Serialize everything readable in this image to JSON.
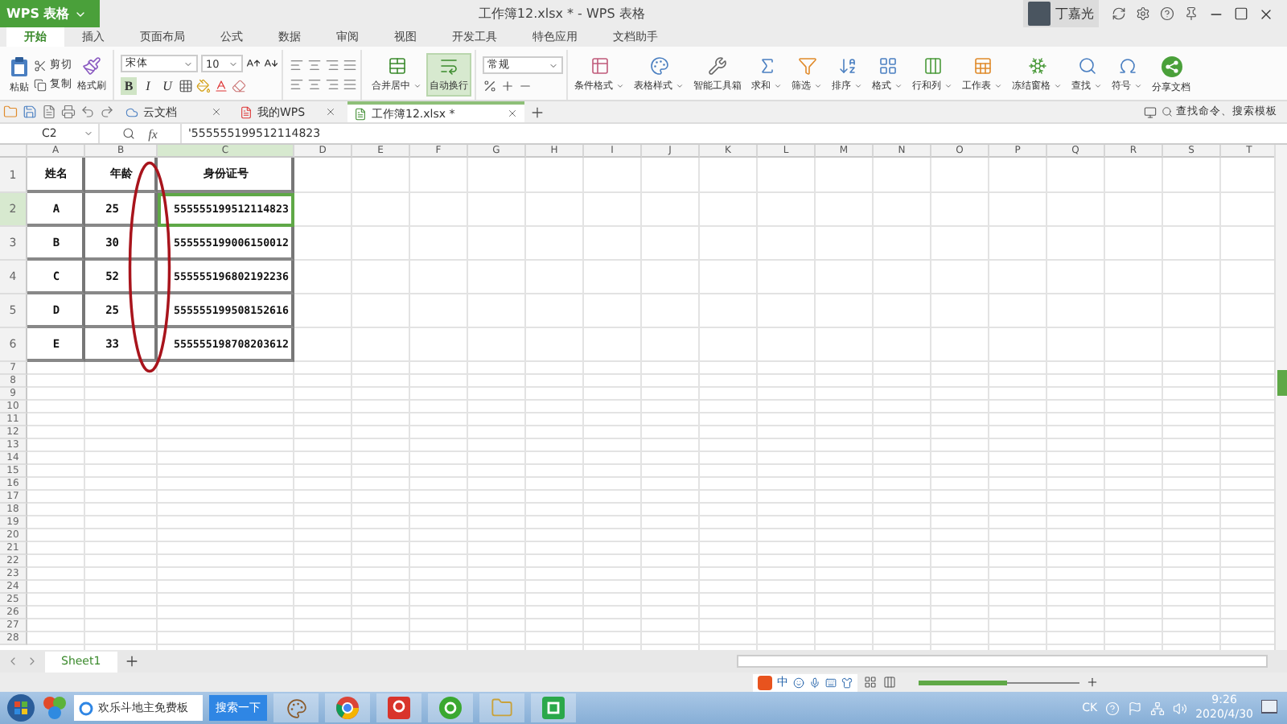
{
  "app_tag": "WPS 表格",
  "title": "工作簿12.xlsx * - WPS 表格",
  "user": "丁嘉光",
  "menu_tabs": [
    {
      "label": "开始",
      "selected": true
    },
    {
      "label": "插入",
      "selected": false
    },
    {
      "label": "页面布局",
      "selected": false
    },
    {
      "label": "公式",
      "selected": false
    },
    {
      "label": "数据",
      "selected": false
    },
    {
      "label": "审阅",
      "selected": false
    },
    {
      "label": "视图",
      "selected": false
    },
    {
      "label": "开发工具",
      "selected": false
    },
    {
      "label": "特色应用",
      "selected": false
    },
    {
      "label": "文档助手",
      "selected": false
    }
  ],
  "clipboard": {
    "paste": "粘贴",
    "cut": "剪切",
    "copy": "复制",
    "format_painter": "格式刷"
  },
  "font": {
    "name": "宋体",
    "size": "10",
    "styles": [
      {
        "label": "B",
        "selected": true
      },
      {
        "label": "I",
        "selected": false
      },
      {
        "label": "U",
        "selected": false
      }
    ]
  },
  "merge_buttons": [
    {
      "label": "合并居中",
      "menu": true,
      "selected": false
    },
    {
      "label": "自动换行",
      "menu": false,
      "selected": true
    }
  ],
  "number_format": "常规",
  "tool_buttons": [
    {
      "label": "条件格式",
      "menu": true
    },
    {
      "label": "表格样式",
      "menu": true
    },
    {
      "label": "智能工具箱",
      "menu": false
    },
    {
      "label": "求和",
      "menu": true
    },
    {
      "label": "筛选",
      "menu": true
    },
    {
      "label": "排序",
      "menu": true
    },
    {
      "label": "格式",
      "menu": true
    },
    {
      "label": "行和列",
      "menu": true
    },
    {
      "label": "工作表",
      "menu": true
    },
    {
      "label": "冻结窗格",
      "menu": true
    },
    {
      "label": "查找",
      "menu": true
    },
    {
      "label": "符号",
      "menu": true
    },
    {
      "label": "分享文档",
      "menu": false
    }
  ],
  "doc_tabs": [
    {
      "label": "云文档",
      "selected": false
    },
    {
      "label": "我的WPS",
      "selected": false
    },
    {
      "label": "工作簿12.xlsx *",
      "selected": true
    }
  ],
  "command_search": {
    "placeholder": "查找命令、搜索模板"
  },
  "name_box": "C2",
  "formula": "'555555199512114823",
  "function_label": "fx",
  "columns": [
    {
      "label": "A",
      "selected": false
    },
    {
      "label": "B",
      "selected": false
    },
    {
      "label": "C",
      "selected": true
    },
    {
      "label": "D",
      "selected": false
    },
    {
      "label": "E",
      "selected": false
    },
    {
      "label": "F",
      "selected": false
    },
    {
      "label": "G",
      "selected": false
    },
    {
      "label": "H",
      "selected": false
    },
    {
      "label": "I",
      "selected": false
    },
    {
      "label": "J",
      "selected": false
    },
    {
      "label": "K",
      "selected": false
    },
    {
      "label": "L",
      "selected": false
    },
    {
      "label": "M",
      "selected": false
    },
    {
      "label": "N",
      "selected": false
    },
    {
      "label": "O",
      "selected": false
    },
    {
      "label": "P",
      "selected": false
    },
    {
      "label": "Q",
      "selected": false
    },
    {
      "label": "R",
      "selected": false
    },
    {
      "label": "S",
      "selected": false
    },
    {
      "label": "T",
      "selected": false
    }
  ],
  "rows": [
    {
      "number": "1",
      "selected": false,
      "cells": [
        "姓名",
        "年龄",
        "身份证号"
      ]
    },
    {
      "number": "2",
      "selected": true,
      "cells": [
        "A",
        "25",
        "555555199512114823"
      ]
    },
    {
      "number": "3",
      "selected": false,
      "cells": [
        "B",
        "30",
        "555555199006150012"
      ]
    },
    {
      "number": "4",
      "selected": false,
      "cells": [
        "C",
        "52",
        "555555196802192236"
      ]
    },
    {
      "number": "5",
      "selected": false,
      "cells": [
        "D",
        "25",
        "555555199508152616"
      ]
    },
    {
      "number": "6",
      "selected": false,
      "cells": [
        "E",
        "33",
        "555555198708203612"
      ]
    }
  ],
  "empty_rows": [
    "7",
    "8",
    "9",
    "10",
    "11",
    "12",
    "13",
    "14",
    "15",
    "16",
    "17",
    "18",
    "19",
    "20",
    "21",
    "22",
    "23",
    "24",
    "25",
    "26",
    "27",
    "28"
  ],
  "sheet_tabs": [
    {
      "label": "Sheet1",
      "selected": true
    }
  ],
  "ime": {
    "label": "中"
  },
  "zoom_slider": {
    "level": 0.55
  },
  "taskbar": {
    "search_text": "欢乐斗地主免费板",
    "search_button": "搜索一下",
    "input_indicator": "CK",
    "time": "9:26",
    "date": "2020/4/30"
  }
}
